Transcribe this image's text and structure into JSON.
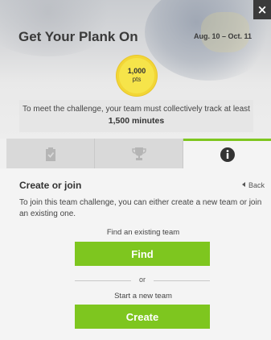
{
  "header": {
    "close_label": "×",
    "title": "Get Your Plank On",
    "date_range": "Aug. 10 – Oct. 11",
    "badge": {
      "value": "1,000",
      "unit": "pts"
    },
    "goal_text": "To meet the challenge, your team must collectively track at least",
    "goal_target": "1,500 minutes"
  },
  "tabs": [
    {
      "icon": "clipboard-check-icon",
      "active": false
    },
    {
      "icon": "trophy-icon",
      "active": false
    },
    {
      "icon": "info-icon",
      "active": true
    }
  ],
  "content": {
    "section_title": "Create or join",
    "back_label": "Back",
    "description": "To join this team challenge, you can either create a new team or join an existing one.",
    "find_label": "Find an existing team",
    "find_button": "Find",
    "or_label": "or",
    "create_label": "Start a new team",
    "create_button": "Create"
  },
  "colors": {
    "accent_green": "#7ec61f",
    "badge_yellow": "#f6e44a",
    "close_bg": "#3b3b3b"
  }
}
